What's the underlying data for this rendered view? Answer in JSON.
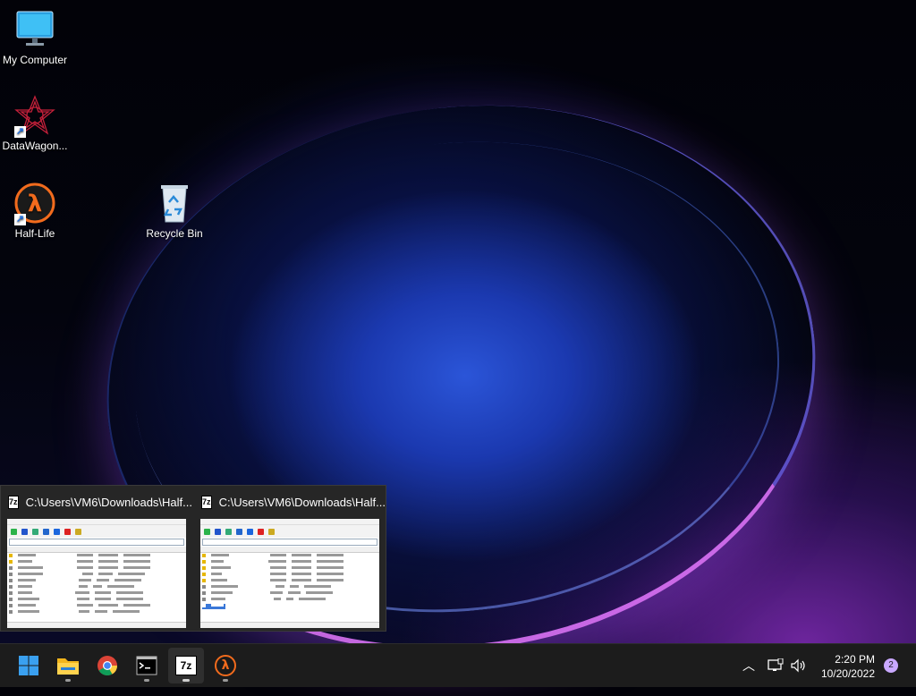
{
  "desktop": {
    "icons": [
      {
        "label": "My Computer",
        "icon": "monitor-icon"
      },
      {
        "label": "DataWagon...",
        "icon": "datawagon-icon"
      },
      {
        "label": "Half-Life",
        "icon": "half-life-icon"
      },
      {
        "label": "Recycle Bin",
        "icon": "recycle-bin-icon"
      }
    ]
  },
  "flyout": {
    "windows": [
      {
        "title": "C:\\Users\\VM6\\Downloads\\Half...",
        "app_icon": "7z"
      },
      {
        "title": "C:\\Users\\VM6\\Downloads\\Half...",
        "app_icon": "7z"
      }
    ]
  },
  "taskbar": {
    "apps": [
      {
        "name": "start",
        "icon": "windows-start-icon"
      },
      {
        "name": "file-explorer",
        "icon": "folder-icon"
      },
      {
        "name": "chrome",
        "icon": "chrome-icon"
      },
      {
        "name": "terminal",
        "icon": "terminal-icon"
      },
      {
        "name": "7-zip",
        "icon": "7z-icon",
        "label": "7z"
      },
      {
        "name": "half-life",
        "icon": "half-life-icon",
        "label": "λ"
      }
    ],
    "clock": {
      "time": "2:20 PM",
      "date": "10/20/2022"
    },
    "notifications": "2"
  },
  "colors": {
    "taskbar_bg": "#1c1c1c",
    "accent": "#c9a8ff",
    "half_life_orange": "#f26b1d"
  }
}
